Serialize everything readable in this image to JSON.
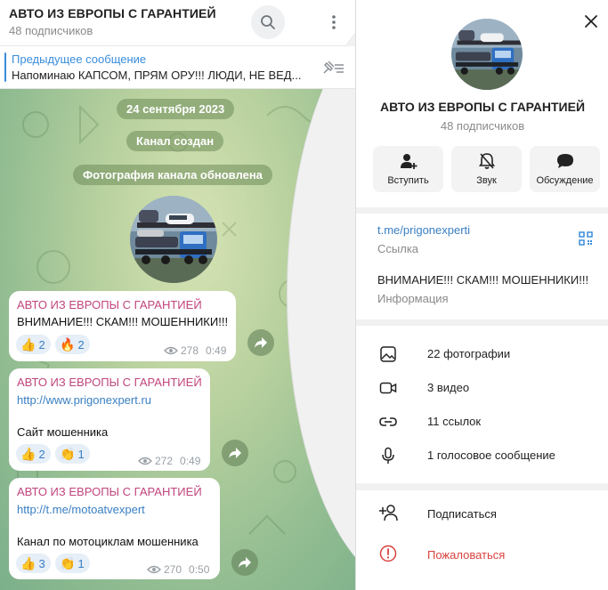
{
  "chat": {
    "title": "АВТО ИЗ ЕВРОПЫ С ГАРАНТИЕЙ",
    "subscribers": "48 подписчиков",
    "pinned": {
      "title": "Предыдущее сообщение",
      "text": "Напоминаю КАПСОМ, ПРЯМ ОРУ!!!  ЛЮДИ, НЕ ВЕД..."
    },
    "service": {
      "date": "24 сентября 2023",
      "created": "Канал создан",
      "photo_updated": "Фотография канала обновлена"
    },
    "messages": [
      {
        "author": "АВТО ИЗ ЕВРОПЫ С ГАРАНТИЕЙ",
        "lines": [
          "ВНИМАНИЕ!!! СКАМ!!! МОШЕННИКИ!!!"
        ],
        "reactions": [
          {
            "emoji": "👍",
            "count": "2"
          },
          {
            "emoji": "🔥",
            "count": "2"
          }
        ],
        "views": "278",
        "time": "0:49"
      },
      {
        "author": "АВТО ИЗ ЕВРОПЫ С ГАРАНТИЕЙ",
        "link": "http://www.prigonexpert.ru",
        "text": "Сайт мошенника",
        "reactions": [
          {
            "emoji": "👍",
            "count": "2"
          },
          {
            "emoji": "👏",
            "count": "1"
          }
        ],
        "views": "272",
        "time": "0:49"
      },
      {
        "author": "АВТО ИЗ ЕВРОПЫ С ГАРАНТИЕЙ",
        "link": "http://t.me/motoatvexpert",
        "text": "Канал по мотоциклам мошенника",
        "reactions": [
          {
            "emoji": "👍",
            "count": "3"
          },
          {
            "emoji": "👏",
            "count": "1"
          }
        ],
        "views": "270",
        "time": "0:50"
      }
    ]
  },
  "panel": {
    "name": "АВТО ИЗ ЕВРОПЫ С ГАРАНТИЕЙ",
    "subscribers": "48 подписчиков",
    "actions": [
      {
        "label": "Вступить",
        "icon": "add-user-icon"
      },
      {
        "label": "Звук",
        "icon": "bell-muted-icon"
      },
      {
        "label": "Обсуждение",
        "icon": "chat-bubble-icon"
      }
    ],
    "info": {
      "link": "t.me/prigonexperti",
      "link_label": "Ссылка",
      "description": "ВНИМАНИЕ!!! СКАМ!!! МОШЕННИКИ!!!",
      "description_label": "Информация"
    },
    "media": [
      {
        "label": "22 фотографии",
        "icon": "photo-icon"
      },
      {
        "label": "3 видео",
        "icon": "video-icon"
      },
      {
        "label": "11 ссылок",
        "icon": "link-icon"
      },
      {
        "label": "1 голосовое сообщение",
        "icon": "microphone-icon"
      }
    ],
    "bottom": {
      "subscribe": "Подписаться",
      "report": "Пожаловаться"
    }
  },
  "colors": {
    "accent": "#3a8ddb",
    "author": "#c0457d",
    "danger": "#d8423f"
  }
}
